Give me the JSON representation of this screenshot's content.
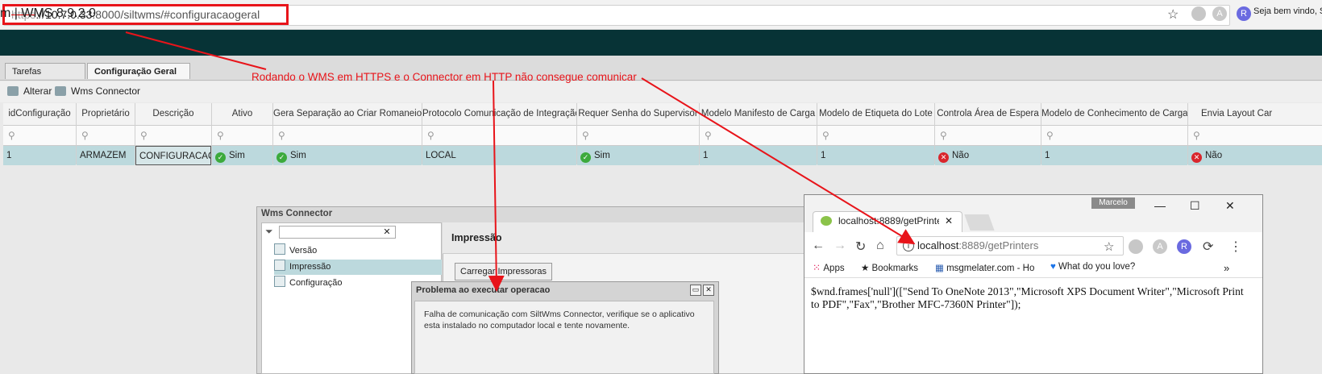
{
  "browser": {
    "url_protocol": "https",
    "url_rest": "://10.7.0.33",
    "url_port_path": ":8000/siltwms/#configuracaogeral",
    "star_icon": "star-icon"
  },
  "app": {
    "title": "m | WMS 8.9.2.0",
    "welcome": "Seja bem vindo, Si"
  },
  "tabs": [
    {
      "label": "Tarefas Principais"
    },
    {
      "label": "Configuração Geral"
    }
  ],
  "toolbar": {
    "alter_label": "Alterar",
    "connector_label": "Wms Connector"
  },
  "annotation": "Rodando o WMS em HTTPS e o Connector em HTTP não consegue comunicar",
  "grid": {
    "columns": [
      "idConfiguração",
      "Proprietário",
      "Descrição",
      "Ativo",
      "Gera Separação ao Criar Romaneio",
      "Protocolo Comunicação de Integração",
      "Requer Senha do Supervisor",
      "Modelo Manifesto de Carga",
      "Modelo de Etiqueta do Lote",
      "Controla Área de Espera",
      "Modelo de Conhecimento de Carga",
      "Envia Layout Car"
    ],
    "row": [
      "1",
      "ARMAZEM",
      "CONFIGURACAO",
      "Sim",
      "Sim",
      "LOCAL",
      "Sim",
      "1",
      "1",
      "Não",
      "1",
      "Não"
    ]
  },
  "connector": {
    "title": "Wms Connector",
    "nodes": [
      "Versão",
      "Impressão",
      "Configuração"
    ],
    "panel_title": "Impressão",
    "load_button": "Carregar Impressoras"
  },
  "error_dialog": {
    "title": "Problema ao executar operacao",
    "message": "Falha de comunicação com SiltWms Connector, verifique se o aplicativo esta instalado no computador local e tente novamente."
  },
  "chrome": {
    "user": "Marcelo",
    "tab_title": "localhost:8889/getPrinters",
    "address_host": "localhost",
    "address_rest": ":8889/getPrinters",
    "bookmarks": [
      "Apps",
      "Bookmarks",
      "msgmelater.com - Ho",
      "What do you love?"
    ],
    "content": "$wnd.frames['null']([\"Send To OneNote 2013\",\"Microsoft XPS Document Writer\",\"Microsoft Print to PDF\",\"Fax\",\"Brother MFC-7360N Printer\"]);"
  },
  "colors": {
    "header_bg": "#073336",
    "row_selected": "#bcd9dd",
    "annotation": "#e8141a",
    "success": "#3caa3c",
    "error": "#d9262c"
  }
}
